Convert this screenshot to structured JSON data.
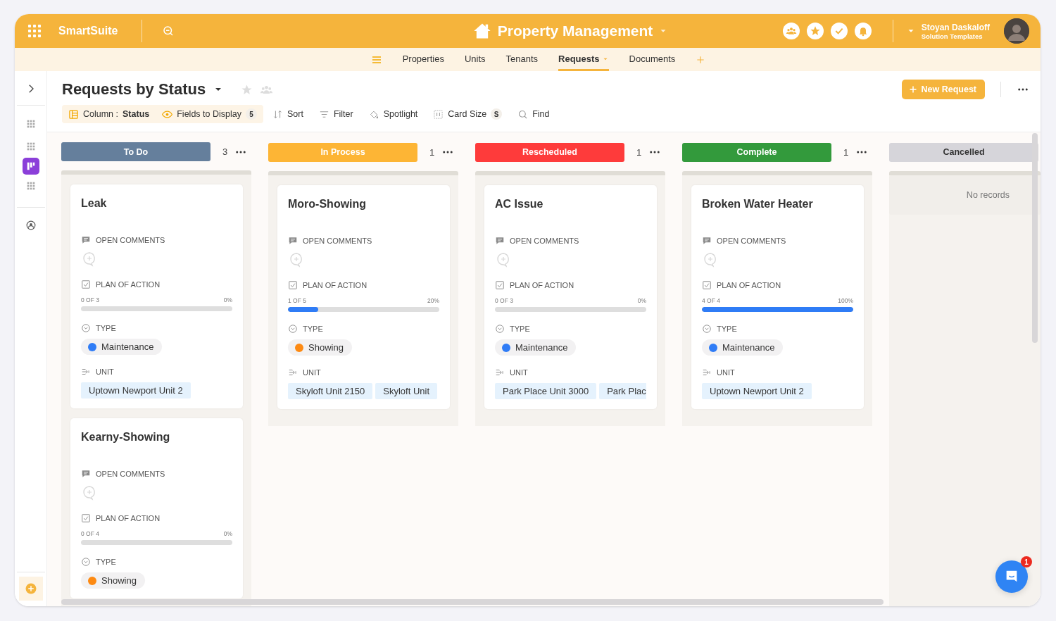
{
  "app": {
    "name": "SmartSuite"
  },
  "workspace": {
    "title": "Property Management"
  },
  "user": {
    "name": "Stoyan Daskaloff",
    "role": "Solution Templates"
  },
  "nav_tabs": [
    {
      "label": "Properties",
      "selected": false
    },
    {
      "label": "Units",
      "selected": false
    },
    {
      "label": "Tenants",
      "selected": false
    },
    {
      "label": "Requests",
      "selected": true
    },
    {
      "label": "Documents",
      "selected": false
    }
  ],
  "view": {
    "title": "Requests by Status"
  },
  "toolbar": [
    {
      "kind": "column",
      "label": "Column :",
      "value": "Status"
    },
    {
      "kind": "fields",
      "label": "Fields to Display",
      "count": "5"
    },
    {
      "kind": "sort",
      "label": "Sort"
    },
    {
      "kind": "filter",
      "label": "Filter"
    },
    {
      "kind": "spotlight",
      "label": "Spotlight"
    },
    {
      "kind": "size",
      "label": "Card Size",
      "count": "S"
    },
    {
      "kind": "find",
      "label": "Find"
    }
  ],
  "new_button": "New Request",
  "columns": [
    {
      "title": "To Do",
      "color": "#657f9c",
      "count": "3",
      "cards": [
        {
          "title": "Leak",
          "fields": [
            {
              "kind": "comments",
              "label": "OPEN COMMENTS"
            },
            {
              "kind": "progress",
              "label": "PLAN OF ACTION",
              "count": "0 OF 3",
              "percent": "0%",
              "level": 0
            },
            {
              "kind": "tag",
              "label": "TYPE",
              "value": "Maintenance",
              "color": "#2f7cf6"
            },
            {
              "kind": "links",
              "label": "UNIT",
              "values": [
                "Uptown Newport Unit 2"
              ]
            }
          ]
        },
        {
          "title": "Kearny-Showing",
          "fields": [
            {
              "kind": "comments",
              "label": "OPEN COMMENTS"
            },
            {
              "kind": "progress",
              "label": "PLAN OF ACTION",
              "count": "0 OF 4",
              "percent": "0%",
              "level": 0
            },
            {
              "kind": "tag",
              "label": "TYPE",
              "value": "Showing",
              "color": "#fd8a12"
            }
          ]
        }
      ]
    },
    {
      "title": "In Process",
      "color": "#fdb535",
      "count": "1",
      "cards": [
        {
          "title": "Moro-Showing",
          "fields": [
            {
              "kind": "comments",
              "label": "OPEN COMMENTS"
            },
            {
              "kind": "progress",
              "label": "PLAN OF ACTION",
              "count": "1 OF 5",
              "percent": "20%",
              "level": 0.2
            },
            {
              "kind": "tag",
              "label": "TYPE",
              "value": "Showing",
              "color": "#fd8a12"
            },
            {
              "kind": "links",
              "label": "UNIT",
              "values": [
                "Skyloft Unit 2150",
                "Skyloft Unit"
              ]
            }
          ]
        }
      ]
    },
    {
      "title": "Rescheduled",
      "color": "#fe3b3b",
      "count": "1",
      "cards": [
        {
          "title": "AC Issue",
          "fields": [
            {
              "kind": "comments",
              "label": "OPEN COMMENTS"
            },
            {
              "kind": "progress",
              "label": "PLAN OF ACTION",
              "count": "0 OF 3",
              "percent": "0%",
              "level": 0
            },
            {
              "kind": "tag",
              "label": "TYPE",
              "value": "Maintenance",
              "color": "#2f7cf6"
            },
            {
              "kind": "links",
              "label": "UNIT",
              "values": [
                "Park Place Unit 3000",
                "Park Plac"
              ]
            }
          ]
        }
      ]
    },
    {
      "title": "Complete",
      "color": "#339a3c",
      "count": "1",
      "cards": [
        {
          "title": "Broken Water Heater",
          "fields": [
            {
              "kind": "comments",
              "label": "OPEN COMMENTS"
            },
            {
              "kind": "progress",
              "label": "PLAN OF ACTION",
              "count": "4 OF 4",
              "percent": "100%",
              "level": 1
            },
            {
              "kind": "tag",
              "label": "TYPE",
              "value": "Maintenance",
              "color": "#2f7cf6"
            },
            {
              "kind": "links",
              "label": "UNIT",
              "values": [
                "Uptown Newport Unit 2"
              ]
            }
          ]
        }
      ]
    },
    {
      "title": "Cancelled",
      "color": "#d6d5da",
      "empty_text": "No records"
    }
  ],
  "chat": {
    "badge": "1"
  }
}
